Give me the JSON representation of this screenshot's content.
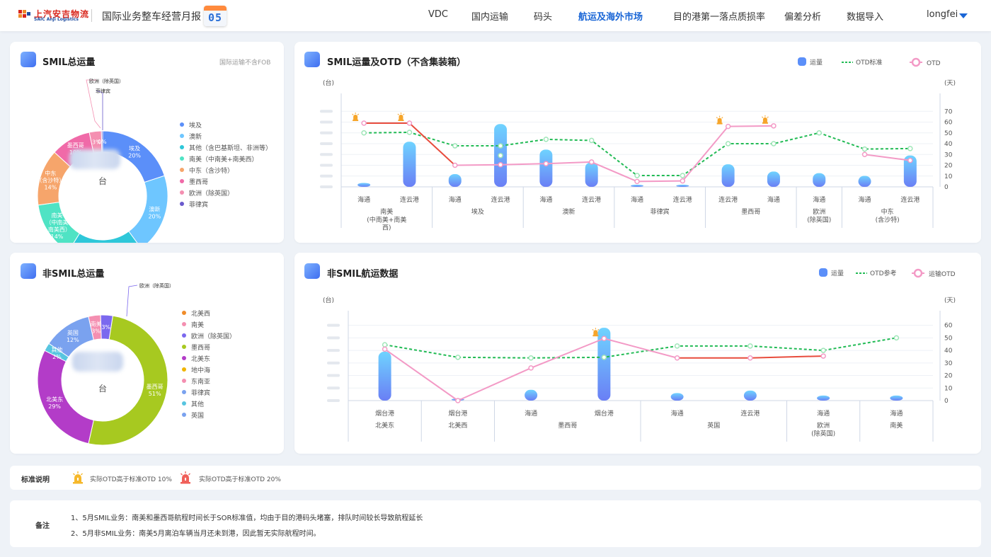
{
  "header": {
    "brand_cn": "上汽安吉物流",
    "brand_en": "SAIC AnJi Logistics",
    "title": "国际业务整车经营月报",
    "month_badge": "05",
    "nav": [
      "VDC",
      "国内运输",
      "码头",
      "航运及海外市场",
      "目的港第一落点质损率",
      "偏差分析",
      "数据导入"
    ],
    "active_nav": "航运及海外市场",
    "user": "longfei"
  },
  "colors": {
    "accent": "#1a66d6",
    "otd_line": "#e84c3d",
    "otd_line_light": "#f39ac6",
    "std_line": "#22bb55",
    "bar": "#5b8ff9"
  },
  "smil_total": {
    "title": "SMIL总运量",
    "note": "国际运输不含FOB",
    "center_unit": "台",
    "slices": [
      {
        "name": "埃及",
        "pct": 20,
        "label": "埃及\n20%",
        "color": "#5b8ff9"
      },
      {
        "name": "澳新",
        "pct": 20,
        "label": "澳新\n20%",
        "color": "#6ec6ff"
      },
      {
        "name": "其他（含巴基斯坦、非洲等）",
        "pct": 19,
        "label": "其他（含巴基斯坦、非洲等）\n19%",
        "color": "#2ec7d9"
      },
      {
        "name": "南美（中南美+南美西）",
        "pct": 14,
        "label": "南美\n（中南美\n+南美西）\n14%",
        "color": "#4fe3c4"
      },
      {
        "name": "中东（含沙特）",
        "pct": 14,
        "label": "中东\n（含沙特）\n14%",
        "color": "#f6a56b"
      },
      {
        "name": "墨西哥",
        "pct": 10,
        "label": "墨西哥\n10%",
        "color": "#f06aa8"
      },
      {
        "name": "欧洲（除英国）",
        "pct": 3,
        "label": "3%",
        "color": "#f48fb1"
      },
      {
        "name": "菲律宾",
        "pct": 0,
        "label": "0%",
        "color": "#6a5acd"
      }
    ],
    "callouts": [
      "欧洲（除英国）",
      "菲律宾"
    ],
    "legend": [
      "埃及",
      "澳新",
      "其他（含巴基斯坦、非洲等）",
      "南美（中南美+南美西）",
      "中东（含沙特）",
      "墨西哥",
      "欧洲（除英国）",
      "菲律宾"
    ]
  },
  "nonsmil_total": {
    "title": "非SMIL总运量",
    "center_unit": "台",
    "callout": "欧洲（除英国）",
    "slices": [
      {
        "name": "墨西哥",
        "pct": 51,
        "label": "墨西哥\n51%",
        "color": "#a7c920"
      },
      {
        "name": "北美东",
        "pct": 29,
        "label": "北美东\n29%",
        "color": "#b33cc8"
      },
      {
        "name": "其他",
        "pct": 2,
        "label": "其他\n2%",
        "color": "#57c5e0"
      },
      {
        "name": "英国",
        "pct": 12,
        "label": "英国\n12%",
        "color": "#7aa2ef"
      },
      {
        "name": "南美",
        "pct": 3,
        "label": "南美\n3%",
        "color": "#f48fb1"
      },
      {
        "name": "欧洲（除英国）",
        "pct": 3,
        "label": "3%",
        "color": "#7b68ee"
      }
    ],
    "legend": [
      {
        "name": "北美西",
        "color": "#f08c2a"
      },
      {
        "name": "南美",
        "color": "#f48fb1"
      },
      {
        "name": "欧洲（除英国）",
        "color": "#7b68ee"
      },
      {
        "name": "墨西哥",
        "color": "#a7c920"
      },
      {
        "name": "北美东",
        "color": "#b33cc8"
      },
      {
        "name": "地中海",
        "color": "#f0b400"
      },
      {
        "name": "东南亚",
        "color": "#f48fb1"
      },
      {
        "name": "菲律宾",
        "color": "#7aa2ef"
      },
      {
        "name": "其他",
        "color": "#57c5e0"
      },
      {
        "name": "英国",
        "color": "#7aa2ef"
      }
    ]
  },
  "chart_data": [
    {
      "type": "bar",
      "title": "SMIL运量及OTD（不含集装箱）",
      "y_unit_left": "(台)",
      "y_unit_right": "(天)",
      "legend": [
        "运量",
        "OTD标准",
        "OTD"
      ],
      "right_ticks": [
        0,
        10,
        20,
        30,
        40,
        50,
        60,
        70
      ],
      "ylim_right": [
        0,
        80
      ],
      "ylim_left": [
        0,
        4400
      ],
      "categories": [
        "海通",
        "连云港",
        "海通",
        "连云港",
        "海通",
        "连云港",
        "海通",
        "连云港",
        "连云港",
        "海通",
        "海通",
        "海通",
        "连云港"
      ],
      "groups": [
        {
          "name": "南美\n(中南美+南美\n西)",
          "span": 2
        },
        {
          "name": "埃及",
          "span": 2
        },
        {
          "name": "澳新",
          "span": 2
        },
        {
          "name": "菲律宾",
          "span": 2
        },
        {
          "name": "墨西哥",
          "span": 2
        },
        {
          "name": "欧洲\n(除英国)",
          "span": 1
        },
        {
          "name": "中东\n(含沙特)",
          "span": 2
        }
      ],
      "series": [
        {
          "name": "运量",
          "values": [
            200,
            2300,
            650,
            3200,
            1900,
            1250,
            80,
            80,
            1150,
            780,
            700,
            560,
            1600
          ]
        },
        {
          "name": "OTD标准",
          "values": [
            50,
            50.5,
            38,
            38,
            44,
            43,
            10.5,
            10.5,
            40,
            40,
            50,
            35,
            35.5
          ]
        },
        {
          "name": "OTD",
          "values": [
            59,
            59,
            20,
            20.5,
            21.5,
            23,
            5,
            5.5,
            56,
            56.5,
            null,
            30,
            24.5
          ]
        }
      ],
      "otd_alerts": [
        0,
        1,
        8,
        9
      ],
      "extra_point": {
        "index": 3,
        "value": 29
      }
    },
    {
      "type": "bar",
      "title": "非SMIL航运数据",
      "y_unit_left": "(台)",
      "y_unit_right": "(天)",
      "legend": [
        "运量",
        "OTD参考",
        "运输OTD"
      ],
      "right_ticks": [
        0,
        10,
        20,
        30,
        40,
        50,
        60
      ],
      "ylim_right": [
        0,
        66
      ],
      "ylim_left": [
        0,
        3300
      ],
      "categories": [
        "烟台港",
        "烟台港",
        "海通",
        "烟台港",
        "海通",
        "连云港",
        "海通",
        "海通"
      ],
      "groups": [
        {
          "name": "北美东",
          "span": 1
        },
        {
          "name": "北美西",
          "span": 1
        },
        {
          "name": "墨西哥",
          "span": 2
        },
        {
          "name": "英国",
          "span": 2
        },
        {
          "name": "欧洲\n(除英国)",
          "span": 1
        },
        {
          "name": "南美",
          "span": 1
        }
      ],
      "series": [
        {
          "name": "运量",
          "values": [
            1950,
            60,
            430,
            2900,
            300,
            400,
            200,
            200
          ]
        },
        {
          "name": "OTD参考",
          "values": [
            44.5,
            34.5,
            34,
            34.5,
            43.5,
            43.5,
            40,
            50
          ]
        },
        {
          "name": "运输OTD",
          "values": [
            41,
            0,
            26,
            49.5,
            34,
            34,
            35.5,
            null
          ]
        }
      ],
      "otd_alerts": [
        3
      ]
    }
  ],
  "standards": {
    "label": "标准说明",
    "items": [
      "实际OTD高于标准OTD 10%",
      "实际OTD高于标准OTD 20%"
    ]
  },
  "remarks": {
    "label": "备注",
    "lines": [
      "1、5月SMIL业务：南美和墨西哥航程时间长于SOR标准值，均由于目的港码头堵塞，排队时间较长导致航程延长",
      "2、5月非SMIL业务：南美5月离泊车辆当月还未到港，因此暂无实际航程时间。"
    ]
  }
}
